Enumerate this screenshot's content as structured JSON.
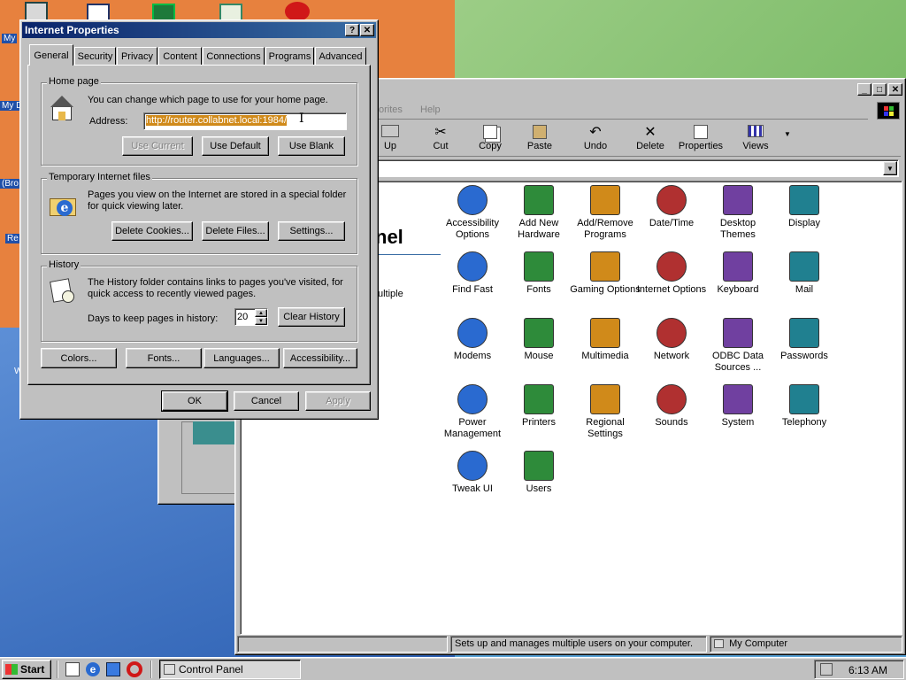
{
  "desktop": {
    "icon_labels": [
      "My",
      "My D",
      "(Bro",
      "Re",
      "W"
    ]
  },
  "control_panel": {
    "menu": {
      "favorites_partial": "orites",
      "help": "Help"
    },
    "toolbar": [
      {
        "label": "Up",
        "icon": "folder-up-icon"
      },
      {
        "label": "Cut",
        "icon": "scissors-icon"
      },
      {
        "label": "Copy",
        "icon": "copy-icon"
      },
      {
        "label": "Paste",
        "icon": "paste-icon"
      },
      {
        "label": "Undo",
        "icon": "undo-icon"
      },
      {
        "label": "Delete",
        "icon": "delete-x-icon"
      },
      {
        "label": "Properties",
        "icon": "properties-icon"
      },
      {
        "label": "Views",
        "icon": "views-icon"
      }
    ],
    "left_pane": {
      "title_partial": "nel",
      "desc_partial": "ultiple"
    },
    "items": [
      "Accessibility Options",
      "Add New Hardware",
      "Add/Remove Programs",
      "Date/Time",
      "Desktop Themes",
      "Display",
      "Find Fast",
      "Fonts",
      "Gaming Options",
      "Internet Options",
      "Keyboard",
      "Mail",
      "Modems",
      "Mouse",
      "Multimedia",
      "Network",
      "ODBC Data Sources ...",
      "Passwords",
      "Power Management",
      "Printers",
      "Regional Settings",
      "Sounds",
      "System",
      "Telephony",
      "Tweak UI",
      "Users"
    ],
    "status": {
      "text": "Sets up and manages multiple users on your computer.",
      "location": "My Computer"
    }
  },
  "dialog": {
    "title": "Internet Properties",
    "help_btn": "?",
    "close_btn": "✕",
    "tabs": [
      "General",
      "Security",
      "Privacy",
      "Content",
      "Connections",
      "Programs",
      "Advanced"
    ],
    "home": {
      "group": "Home page",
      "desc": "You can change which page to use for your home page.",
      "address_label": "Address:",
      "address_value": "http://router.collabnet.local:1984/",
      "use_current": "Use Current",
      "use_default": "Use Default",
      "use_blank": "Use Blank"
    },
    "temp": {
      "group": "Temporary Internet files",
      "desc1": "Pages you view on the Internet are stored in a special folder",
      "desc2": "for quick viewing later.",
      "delete_cookies": "Delete Cookies...",
      "delete_files": "Delete Files...",
      "settings": "Settings..."
    },
    "history": {
      "group": "History",
      "desc1": "The History folder contains links to pages you've visited, for",
      "desc2": "quick access to recently viewed pages.",
      "days_label": "Days to keep pages in history:",
      "days_value": "20",
      "clear": "Clear History"
    },
    "bottom": {
      "colors": "Colors...",
      "fonts": "Fonts...",
      "languages": "Languages...",
      "accessibility": "Accessibility..."
    },
    "ok": "OK",
    "cancel": "Cancel",
    "apply": "Apply"
  },
  "taskbar": {
    "start": "Start",
    "task": "Control Panel",
    "time": "6:13 AM"
  }
}
